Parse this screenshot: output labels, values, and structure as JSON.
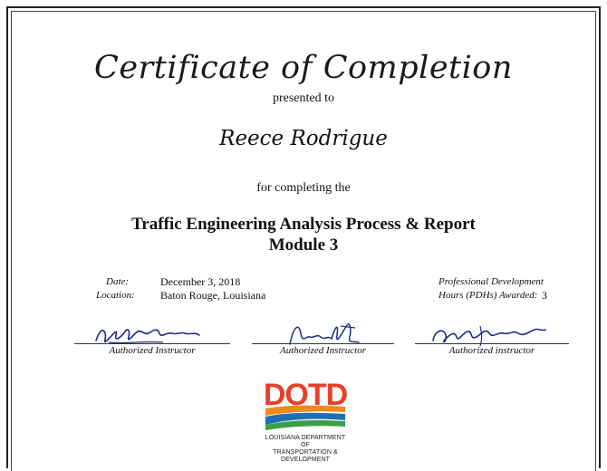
{
  "certificate": {
    "title": "Certificate of Completion",
    "presented_to": "presented to",
    "recipient": "Reece Rodrigue",
    "for_completing": "for completing the",
    "course_line1": "Traffic Engineering Analysis Process & Report",
    "course_line2": "Module 3"
  },
  "details": {
    "date_label": "Date:",
    "date_value": "December 3, 2018",
    "location_label": "Location:",
    "location_value": "Baton Rouge, Louisiana",
    "pdh_label_line1": "Professional Development",
    "pdh_label_line2": "Hours (PDHs) Awarded:",
    "pdh_value": "3"
  },
  "signatures": [
    {
      "caption": "Authorized Instructor"
    },
    {
      "caption": "Authorized Instructor"
    },
    {
      "caption": "Authorized instructor"
    }
  ],
  "logo": {
    "text": "DOTD",
    "sub_line1": "LOUISIANA DEPARTMENT OF",
    "sub_line2": "TRANSPORTATION & DEVELOPMENT",
    "colors": {
      "red": "#e8402a",
      "orange": "#f08a1c",
      "blue": "#1f6fb5",
      "green": "#3aa048"
    }
  }
}
